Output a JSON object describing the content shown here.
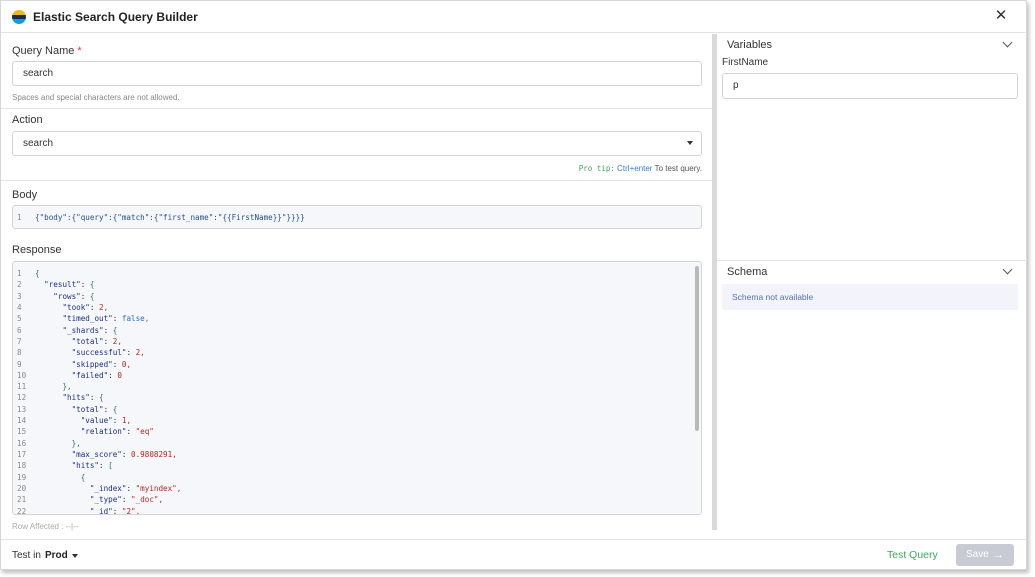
{
  "app": {
    "title": "Elastic Search Query Builder"
  },
  "query_name": {
    "label": "Query Name",
    "required_mark": "*",
    "value": "search",
    "hint": "Spaces and special characters are not allowed."
  },
  "action": {
    "label": "Action",
    "value": "search",
    "pro_tip_label": "Pro tip:",
    "pro_tip_keys": "Ctrl+enter",
    "pro_tip_text": "To test query."
  },
  "body": {
    "label": "Body",
    "line_number": "1",
    "code": "{\"body\":{\"query\":{\"match\":{\"first_name\":\"{{FirstName}}\"}}}}"
  },
  "response": {
    "label": "Response",
    "lines": [
      {
        "n": "1",
        "indent": "",
        "key": "",
        "value": "{",
        "vtype": "p"
      },
      {
        "n": "2",
        "indent": "  ",
        "key": "\"result\"",
        "value": "{",
        "vtype": "p"
      },
      {
        "n": "3",
        "indent": "    ",
        "key": "\"rows\"",
        "value": "{",
        "vtype": "p"
      },
      {
        "n": "4",
        "indent": "      ",
        "key": "\"took\"",
        "value": "2,",
        "vtype": "num"
      },
      {
        "n": "5",
        "indent": "      ",
        "key": "\"timed_out\"",
        "value": "false,",
        "vtype": "b"
      },
      {
        "n": "6",
        "indent": "      ",
        "key": "\"_shards\"",
        "value": "{",
        "vtype": "p"
      },
      {
        "n": "7",
        "indent": "        ",
        "key": "\"total\"",
        "value": "2,",
        "vtype": "num"
      },
      {
        "n": "8",
        "indent": "        ",
        "key": "\"successful\"",
        "value": "2,",
        "vtype": "num"
      },
      {
        "n": "9",
        "indent": "        ",
        "key": "\"skipped\"",
        "value": "0,",
        "vtype": "num"
      },
      {
        "n": "10",
        "indent": "        ",
        "key": "\"failed\"",
        "value": "0",
        "vtype": "num"
      },
      {
        "n": "11",
        "indent": "      ",
        "key": "",
        "value": "},",
        "vtype": "p"
      },
      {
        "n": "12",
        "indent": "      ",
        "key": "\"hits\"",
        "value": "{",
        "vtype": "p"
      },
      {
        "n": "13",
        "indent": "        ",
        "key": "\"total\"",
        "value": "{",
        "vtype": "p"
      },
      {
        "n": "14",
        "indent": "          ",
        "key": "\"value\"",
        "value": "1,",
        "vtype": "num"
      },
      {
        "n": "15",
        "indent": "          ",
        "key": "\"relation\"",
        "value": "\"eq\"",
        "vtype": "s"
      },
      {
        "n": "16",
        "indent": "        ",
        "key": "",
        "value": "},",
        "vtype": "p"
      },
      {
        "n": "17",
        "indent": "        ",
        "key": "\"max_score\"",
        "value": "0.9808291,",
        "vtype": "num"
      },
      {
        "n": "18",
        "indent": "        ",
        "key": "\"hits\"",
        "value": "[",
        "vtype": "p"
      },
      {
        "n": "19",
        "indent": "          ",
        "key": "",
        "value": "{",
        "vtype": "p"
      },
      {
        "n": "20",
        "indent": "            ",
        "key": "\"_index\"",
        "value": "\"myindex\",",
        "vtype": "s"
      },
      {
        "n": "21",
        "indent": "            ",
        "key": "\"_type\"",
        "value": "\"_doc\",",
        "vtype": "s"
      },
      {
        "n": "22",
        "indent": "            ",
        "key": "\"_id\"",
        "value": "\"2\",",
        "vtype": "s"
      }
    ],
    "rows_affected": "Row Affected : --|--"
  },
  "variables": {
    "title": "Variables",
    "name": "FirstName",
    "value": "p"
  },
  "schema": {
    "title": "Schema",
    "message": "Schema not available"
  },
  "footer": {
    "test_in_label": "Test in",
    "environment": "Prod",
    "test_query_label": "Test Query",
    "save_label": "Save",
    "save_arrow": "→"
  },
  "colors": {
    "logo_top": "#f0b429",
    "logo_mid": "#1f2b49",
    "logo_bottom": "#00a3e0",
    "accent_green": "#3aa85c",
    "save_disabled": "#c8cbd3"
  }
}
